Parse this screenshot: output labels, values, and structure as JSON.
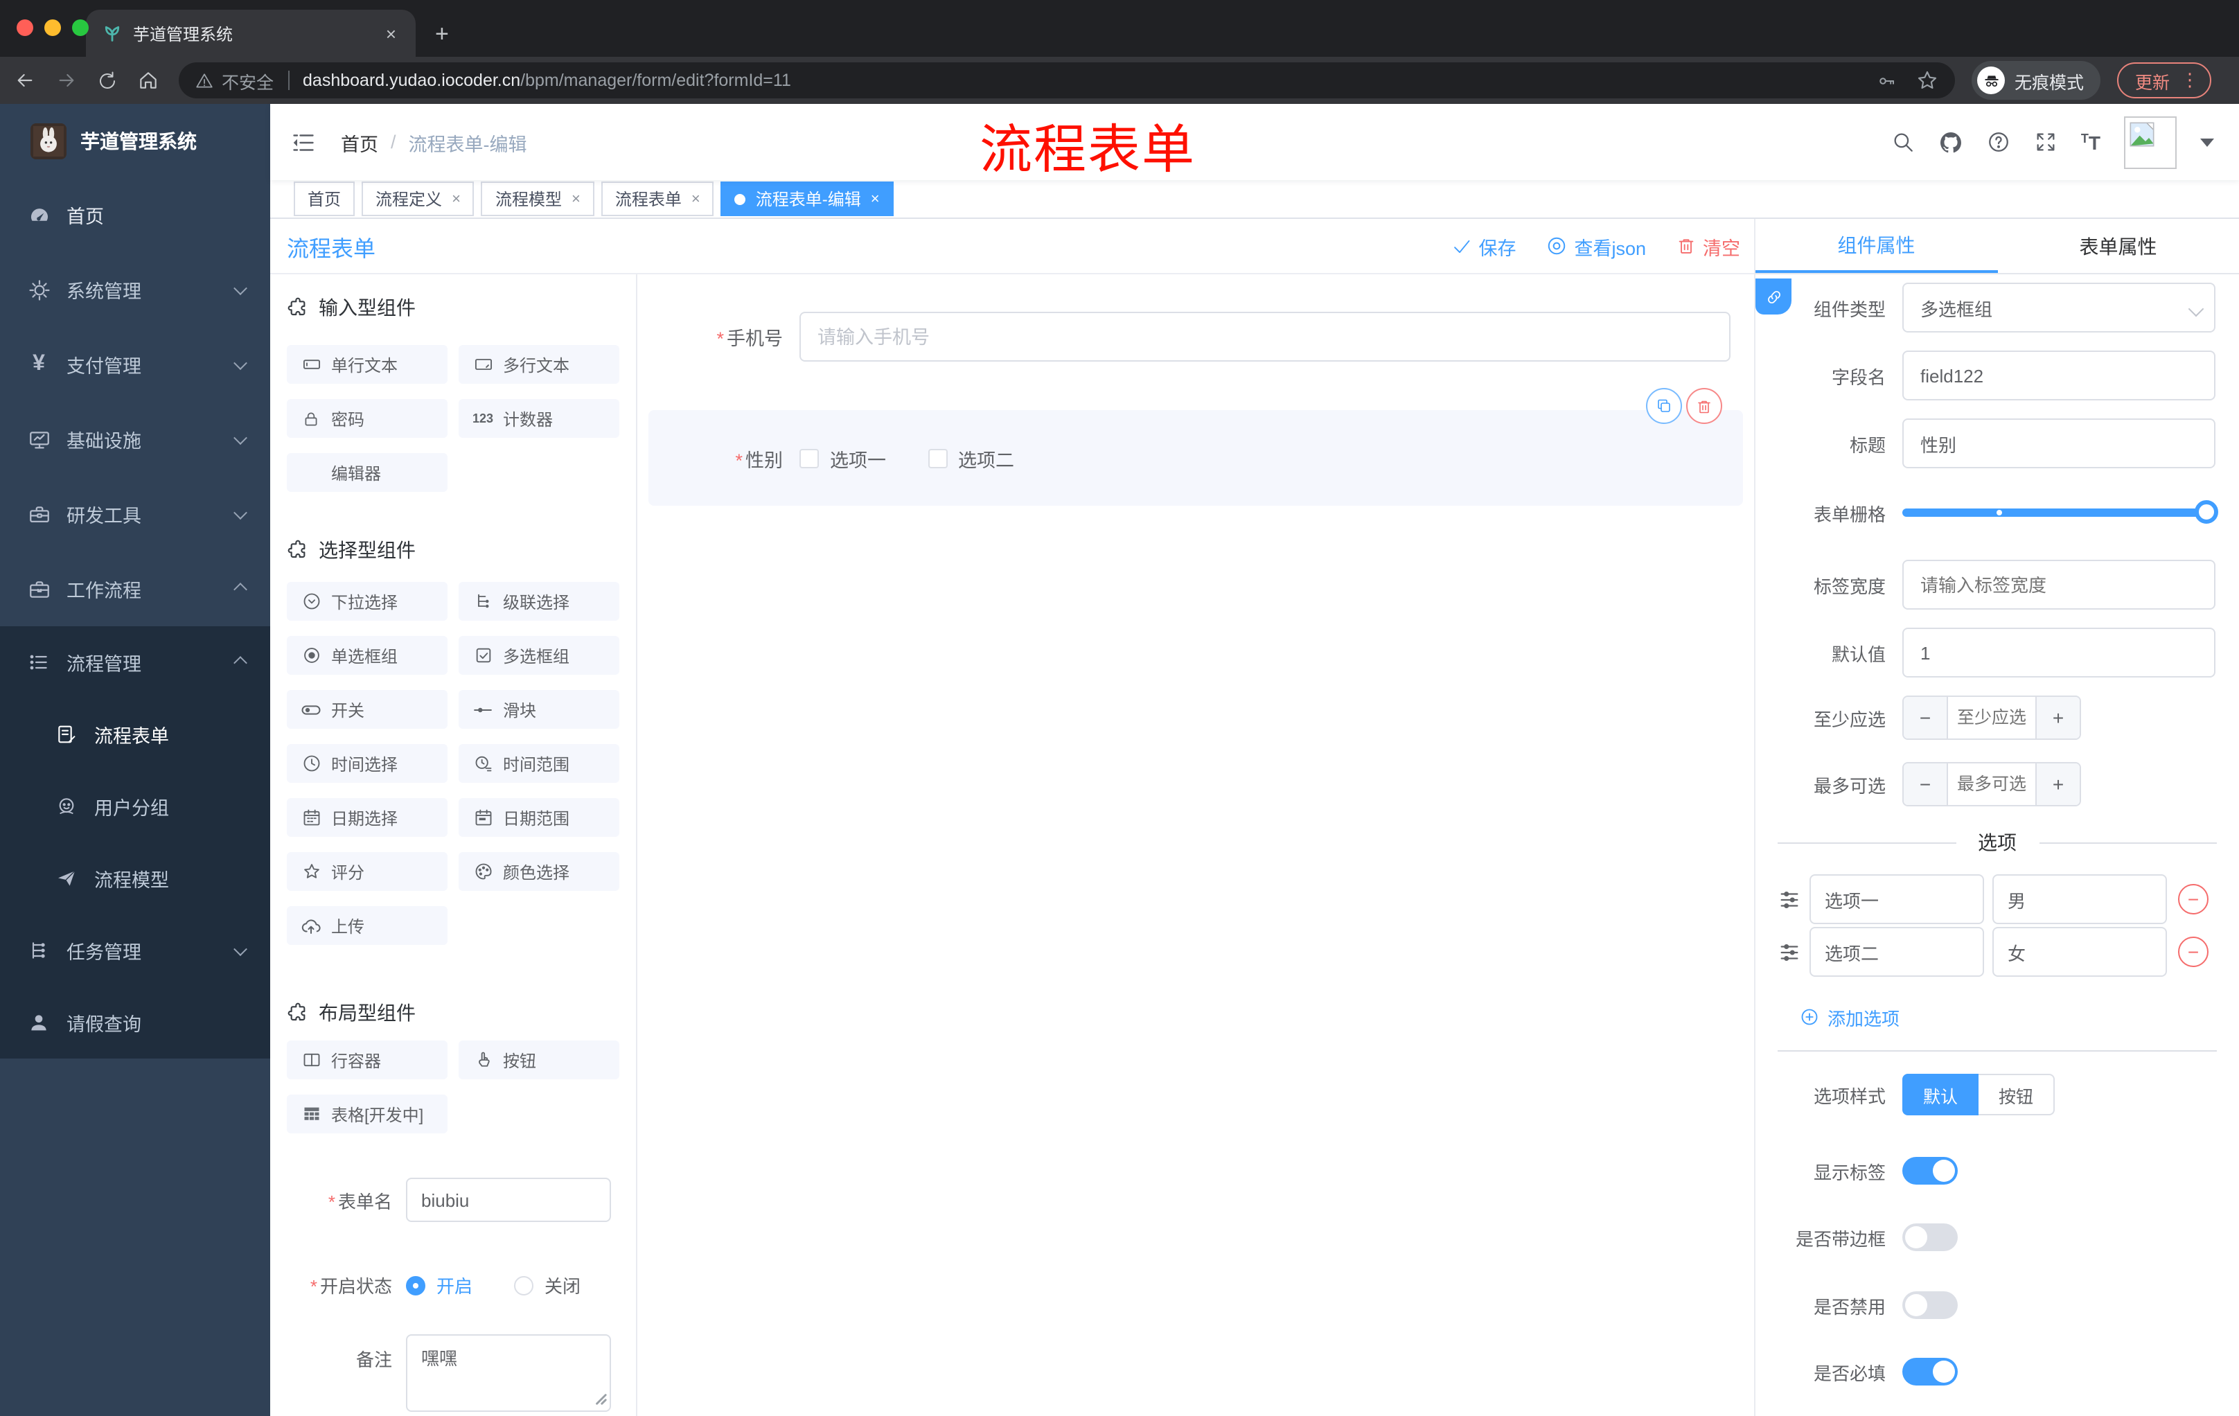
{
  "browser": {
    "tab_title": "芋道管理系统",
    "close_tab": "×",
    "new_tab": "+",
    "url_security": "不安全",
    "url_host": "dashboard.yudao.iocoder.cn",
    "url_path": "/bpm/manager/form/edit?formId=11",
    "incognito_label": "无痕模式",
    "update_label": "更新",
    "menu_dots": "⋮"
  },
  "sidebar": {
    "brand": "芋道管理系统",
    "menu": [
      {
        "label": "首页",
        "icon": "dashboard-icon"
      },
      {
        "label": "系统管理",
        "icon": "gear-icon"
      },
      {
        "label": "支付管理",
        "icon": "yen-icon",
        "yen": "¥"
      },
      {
        "label": "基础设施",
        "icon": "monitor-icon"
      },
      {
        "label": "研发工具",
        "icon": "toolbox-icon"
      },
      {
        "label": "工作流程",
        "icon": "briefcase-icon"
      }
    ],
    "submenu": [
      {
        "label": "流程管理",
        "icon": "list-icon"
      },
      {
        "label": "流程表单",
        "icon": "form-icon"
      },
      {
        "label": "用户分组",
        "icon": "group-icon"
      },
      {
        "label": "流程模型",
        "icon": "model-icon"
      },
      {
        "label": "任务管理",
        "icon": "task-icon"
      },
      {
        "label": "请假查询",
        "icon": "user-icon"
      }
    ]
  },
  "header": {
    "breadcrumb_home": "首页",
    "breadcrumb_sep": "/",
    "breadcrumb_current": "流程表单-编辑",
    "annotation": "流程表单"
  },
  "tags": [
    {
      "label": "首页"
    },
    {
      "label": "流程定义",
      "close": "×"
    },
    {
      "label": "流程模型",
      "close": "×"
    },
    {
      "label": "流程表单",
      "close": "×"
    },
    {
      "label": "流程表单-编辑",
      "close": "×"
    }
  ],
  "toolbar": {
    "title": "流程表单",
    "save": "保存",
    "view_json": "查看json",
    "clear": "清空"
  },
  "components": {
    "sections": [
      {
        "title": "输入型组件"
      },
      {
        "title": "选择型组件"
      },
      {
        "title": "布局型组件"
      }
    ],
    "items1": [
      {
        "label": "单行文本"
      },
      {
        "label": "多行文本"
      },
      {
        "label": "密码"
      },
      {
        "label": "计数器"
      },
      {
        "label": "编辑器"
      }
    ],
    "items2": [
      {
        "label": "下拉选择"
      },
      {
        "label": "级联选择"
      },
      {
        "label": "单选框组"
      },
      {
        "label": "多选框组"
      },
      {
        "label": "开关"
      },
      {
        "label": "滑块"
      },
      {
        "label": "时间选择"
      },
      {
        "label": "时间范围"
      },
      {
        "label": "日期选择"
      },
      {
        "label": "日期范围"
      },
      {
        "label": "评分"
      },
      {
        "label": "颜色选择"
      },
      {
        "label": "上传"
      }
    ],
    "items3": [
      {
        "label": "行容器"
      },
      {
        "label": "按钮"
      },
      {
        "label": "表格[开发中]"
      }
    ],
    "form": {
      "name_label": "表单名",
      "name_value": "biubiu",
      "status_label": "开启状态",
      "status_on": "开启",
      "status_off": "关闭",
      "remark_label": "备注",
      "remark_value": "嘿嘿"
    }
  },
  "canvas": {
    "phone_label": "手机号",
    "phone_placeholder": "请输入手机号",
    "gender_label": "性别",
    "gender_option1": "选项一",
    "gender_option2": "选项二"
  },
  "props": {
    "tab_component": "组件属性",
    "tab_form": "表单属性",
    "type_label": "组件类型",
    "type_value": "多选框组",
    "field_label": "字段名",
    "field_value": "field122",
    "title_label": "标题",
    "title_value": "性别",
    "grid_label": "表单栅格",
    "width_label": "标签宽度",
    "width_placeholder": "请输入标签宽度",
    "default_label": "默认值",
    "default_value": "1",
    "min_label": "至少应选",
    "min_placeholder": "至少应选",
    "max_label": "最多可选",
    "max_placeholder": "最多可选",
    "options_title": "选项",
    "options": [
      {
        "label": "选项一",
        "value": "男"
      },
      {
        "label": "选项二",
        "value": "女"
      }
    ],
    "add_option": "添加选项",
    "style_label": "选项样式",
    "style_default": "默认",
    "style_button": "按钮",
    "toggle_show_label": "显示标签",
    "toggle_border_label": "是否带边框",
    "toggle_disabled_label": "是否禁用",
    "toggle_required_label": "是否必填"
  },
  "colors": {
    "accent": "#409eff",
    "danger": "#f56c6c",
    "sidebar_bg": "#304156",
    "submenu_bg": "#1f2d3d",
    "annotation_red": "#fe1000"
  }
}
